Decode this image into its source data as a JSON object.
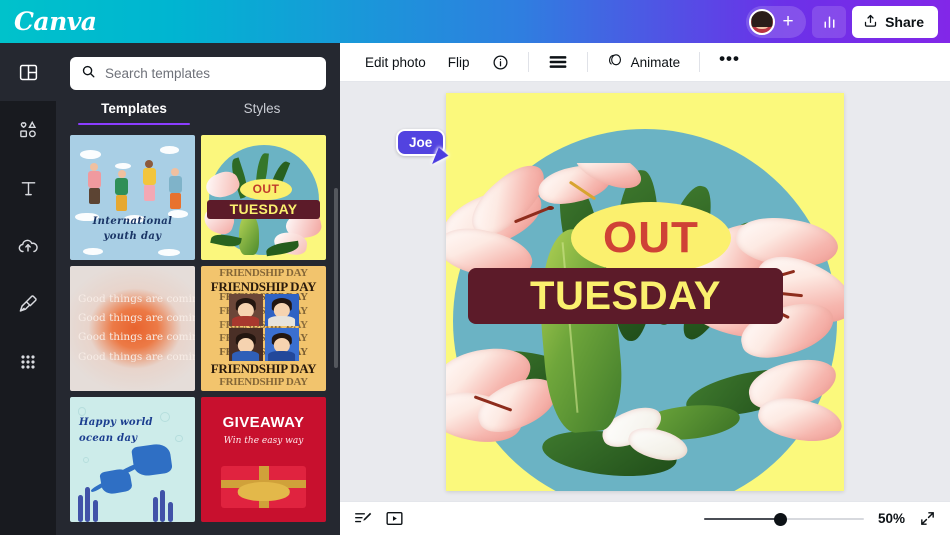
{
  "header": {
    "logo": "Canva",
    "avatar_name": "avatar",
    "add_collaborator": "+",
    "analytics_icon": "bar-chart-icon",
    "share_label": "Share"
  },
  "rail": {
    "items": [
      {
        "id": "templates",
        "icon": "templates-icon",
        "active": true
      },
      {
        "id": "elements",
        "icon": "shapes-icon",
        "active": false
      },
      {
        "id": "text",
        "icon": "text-t-icon",
        "active": false
      },
      {
        "id": "uploads",
        "icon": "cloud-upload-icon",
        "active": false
      },
      {
        "id": "draw",
        "icon": "marker-pen-icon",
        "active": false
      },
      {
        "id": "apps",
        "icon": "grid-dots-icon",
        "active": false
      }
    ]
  },
  "panel": {
    "search": {
      "placeholder": "Search templates",
      "value": "",
      "icon": "search-icon"
    },
    "tabs": [
      {
        "label": "Templates",
        "active": true
      },
      {
        "label": "Styles",
        "active": false
      }
    ],
    "templates": [
      {
        "id": "youth-day",
        "title_line1": "International",
        "title_line2": "youth day"
      },
      {
        "id": "out-tuesday",
        "word1": "OUT",
        "word2": "TUESDAY"
      },
      {
        "id": "good-things",
        "line": "Good things are coming"
      },
      {
        "id": "friendship-day",
        "band": "FRIENDSHIP DAY"
      },
      {
        "id": "ocean-day",
        "title_line1": "Happy world",
        "title_line2": "ocean day"
      },
      {
        "id": "giveaway",
        "title": "GIVEAWAY",
        "subtitle": "Win the easy way"
      }
    ]
  },
  "toolbar": {
    "edit_photo": "Edit photo",
    "flip": "Flip",
    "info_icon": "info-circle-icon",
    "position_icon": "position-lines-icon",
    "animate_icon": "animate-circle-icon",
    "animate": "Animate",
    "more": "•••"
  },
  "canvas": {
    "word_out": "OUT",
    "word_tuesday": "TUESDAY",
    "background_color": "#fbf97c",
    "circle_color": "#6bb3c4",
    "oval_color": "#fbf06e",
    "out_text_color": "#cf4236",
    "bar_color": "#5c1b29",
    "tuesday_text_color": "#fbf06e"
  },
  "cursor": {
    "name": "Joe",
    "color": "#5243e0"
  },
  "bottom": {
    "notes_icon": "notes-edit-icon",
    "present_icon": "present-play-icon",
    "zoom_value": "50%",
    "zoom_percent": 48,
    "fullscreen_icon": "expand-arrows-icon"
  }
}
